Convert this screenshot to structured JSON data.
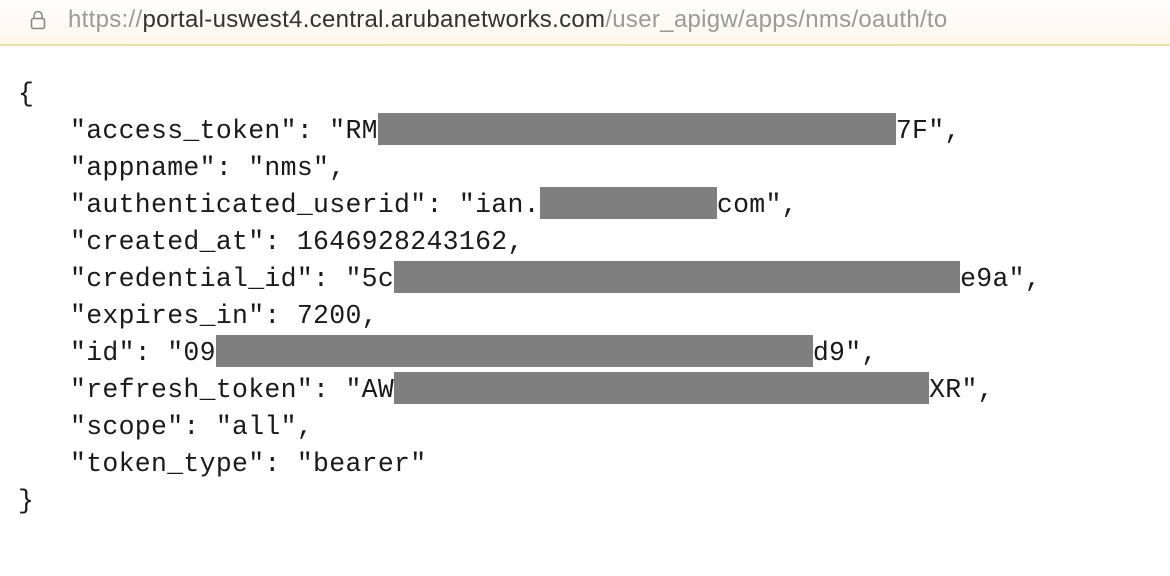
{
  "address": {
    "scheme": "https://",
    "host": "portal-uswest4.central.arubanetworks.com",
    "path": "/user_apigw/apps/nms/oauth/to"
  },
  "json": {
    "open_brace": "{",
    "close_brace": "}",
    "lines": {
      "access_token": {
        "key": "\"access_token\": \"RM",
        "suffix": "7F\","
      },
      "appname": "\"appname\": \"nms\",",
      "authenticated_userid": {
        "prefix": "\"authenticated_userid\": \"ian.",
        "suffix": "com\","
      },
      "created_at": "\"created_at\": 1646928243162,",
      "credential_id": {
        "prefix": "\"credential_id\": \"5c",
        "suffix": "e9a\","
      },
      "expires_in": "\"expires_in\": 7200,",
      "id": {
        "prefix": "\"id\": \"09",
        "suffix": "d9\","
      },
      "refresh_token": {
        "prefix": "\"refresh_token\": \"AW",
        "suffix": "XR\","
      },
      "scope": "\"scope\": \"all\",",
      "token_type": "\"token_type\": \"bearer\""
    }
  }
}
